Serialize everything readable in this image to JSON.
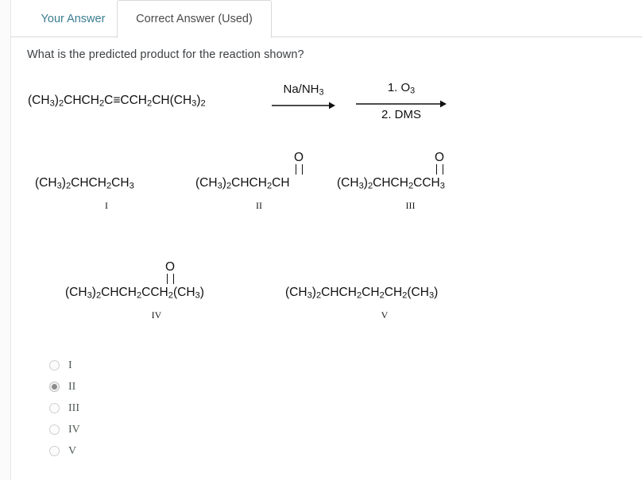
{
  "tabs": [
    {
      "id": "your-answer",
      "label": "Your Answer",
      "active": false
    },
    {
      "id": "correct-answer",
      "label": "Correct Answer (Used)",
      "active": true
    }
  ],
  "question": {
    "text": "What is the predicted product for the reaction shown?"
  },
  "reaction": {
    "reactant": {
      "formula_html": "(CH<sub>3</sub>)<sub>2</sub>CHCH<sub>2</sub>C≡CCH<sub>2</sub>CH(CH<sub>3</sub>)<sub>2</sub>",
      "plain": "(CH3)2CHCH2C#CCH2CH(CH3)2"
    },
    "arrows": [
      {
        "id": "arrow-1",
        "label_top_html": "Na/NH<sub>3</sub>",
        "label_top_plain": "Na/NH3",
        "label_bottom_html": "",
        "has_divider": false
      },
      {
        "id": "arrow-2",
        "label_top_html": "1. O<sub>3</sub>",
        "label_top_plain": "1. O3",
        "label_bottom_html": "2. DMS",
        "has_divider": true
      }
    ]
  },
  "structures": [
    {
      "id": "I",
      "numeral": "I",
      "formula_html": "(CH<sub>3</sub>)<sub>2</sub>CHCH<sub>2</sub>CH<sub>3</sub>",
      "plain": "(CH3)2CHCH2CH3",
      "carbonyl": false
    },
    {
      "id": "II",
      "numeral": "II",
      "formula_html": "(CH<sub>3</sub>)<sub>2</sub>CHCH<sub>2</sub>CH",
      "plain": "(CH3)2CHCH2CHO",
      "carbonyl": true,
      "carbonyl_oxygen": "O"
    },
    {
      "id": "III",
      "numeral": "III",
      "formula_html": "(CH<sub>3</sub>)<sub>2</sub>CHCH<sub>2</sub>CCH<sub>3</sub>",
      "plain": "(CH3)2CHCH2C(O)CH3",
      "carbonyl": true,
      "carbonyl_oxygen": "O"
    },
    {
      "id": "IV",
      "numeral": "IV",
      "formula_html": "(CH<sub>3</sub>)<sub>2</sub>CHCH<sub>2</sub>CCH<sub>2</sub>(CH<sub>3</sub>)",
      "plain": "(CH3)2CHCH2C(O)CH2(CH3)",
      "carbonyl": true,
      "carbonyl_oxygen": "O"
    },
    {
      "id": "V",
      "numeral": "V",
      "formula_html": "(CH<sub>3</sub>)<sub>2</sub>CHCH<sub>2</sub>CH<sub>2</sub>CH<sub>2</sub>(CH<sub>3</sub>)",
      "plain": "(CH3)2CHCH2CH2CH2(CH3)",
      "carbonyl": false
    }
  ],
  "options": [
    {
      "value": "I",
      "label": "I",
      "selected": false
    },
    {
      "value": "II",
      "label": "II",
      "selected": true
    },
    {
      "value": "III",
      "label": "III",
      "selected": false
    },
    {
      "value": "IV",
      "label": "IV",
      "selected": false
    },
    {
      "value": "V",
      "label": "V",
      "selected": false
    }
  ],
  "colors": {
    "inactive_tab_text": "#3a7d91",
    "active_tab_text": "#4a4a4a",
    "question_text": "#3c4043",
    "structure_text": "#111111",
    "option_label": "#4f5b52",
    "radio_dot": "#8c8c8c",
    "border": "#d9d9d9",
    "page_background": "#fbfbfb",
    "card_background": "#ffffff"
  }
}
